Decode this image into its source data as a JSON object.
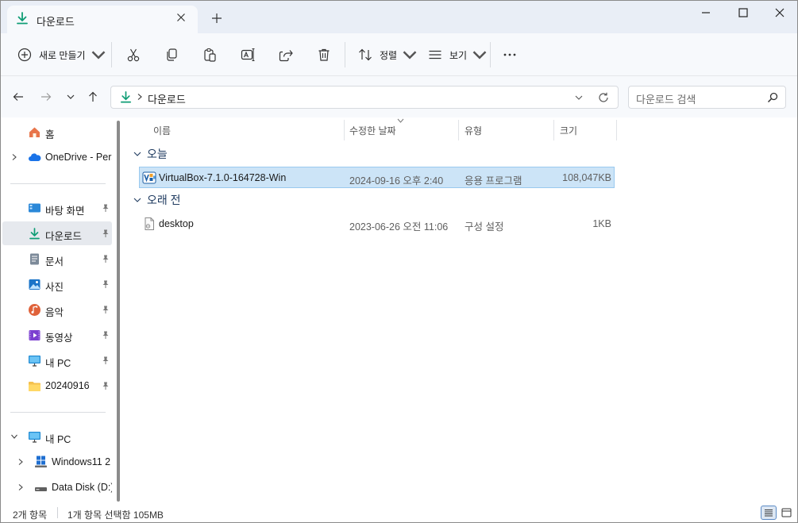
{
  "tab": {
    "title": "다운로드",
    "icon": "download-icon"
  },
  "toolbar": {
    "new_label": "새로 만들기",
    "sort_label": "정렬",
    "view_label": "보기",
    "icons": [
      "cut-icon",
      "copy-icon",
      "paste-icon",
      "rename-icon",
      "share-icon",
      "delete-icon",
      "more-icon"
    ]
  },
  "address": {
    "path_item": "다운로드"
  },
  "search": {
    "placeholder": "다운로드 검색"
  },
  "sidebar": {
    "items": [
      {
        "label": "홈",
        "icon": "home-icon"
      },
      {
        "label": "OneDrive - Pers",
        "icon": "onedrive-cloud-icon"
      },
      {
        "label": "바탕 화면",
        "icon": "desktop-icon"
      },
      {
        "label": "다운로드",
        "icon": "download-icon"
      },
      {
        "label": "문서",
        "icon": "documents-icon"
      },
      {
        "label": "사진",
        "icon": "pictures-icon"
      },
      {
        "label": "음악",
        "icon": "music-icon"
      },
      {
        "label": "동영상",
        "icon": "videos-icon"
      },
      {
        "label": "내 PC",
        "icon": "pc-icon"
      },
      {
        "label": "20240916",
        "icon": "folder-icon"
      },
      {
        "label": "내 PC",
        "icon": "pc-icon"
      },
      {
        "label": "Windows11 2",
        "icon": "windows-drive-icon"
      },
      {
        "label": "Data Disk (D:)",
        "icon": "disk-drive-icon"
      }
    ]
  },
  "columns": {
    "name": "이름",
    "modified": "수정한 날짜",
    "type": "유형",
    "size": "크기"
  },
  "groups": [
    {
      "label": "오늘",
      "files": [
        {
          "name": "VirtualBox-7.1.0-164728-Win",
          "date": "2024-09-16 오후 2:40",
          "type": "응용 프로그램",
          "size": "108,047KB",
          "icon": "virtualbox-icon"
        }
      ]
    },
    {
      "label": "오래 전",
      "files": [
        {
          "name": "desktop",
          "date": "2023-06-26 오전 11:06",
          "type": "구성 설정",
          "size": "1KB",
          "icon": "settings-file-icon"
        }
      ]
    }
  ],
  "status": {
    "item_count": "2개 항목",
    "selection": "1개 항목 선택함 105MB"
  },
  "colors": {
    "accent": "#0f9d75",
    "selection": "#cce4f7",
    "selection_border": "#99c9ef",
    "titlebar": "#e9eef6"
  }
}
